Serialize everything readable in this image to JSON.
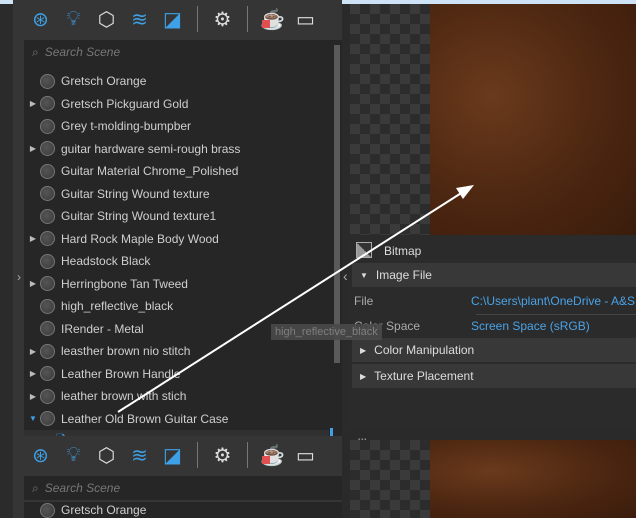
{
  "toolbar": {
    "icons": [
      "material-icon",
      "light-icon",
      "object-icon",
      "layers-icon",
      "texture-icon",
      "gear-icon",
      "teapot-render-icon",
      "window-icon"
    ]
  },
  "search": {
    "placeholder": "Search Scene"
  },
  "materials": [
    {
      "label": "Gretsch Orange",
      "expandable": false
    },
    {
      "label": "Gretsch Pickguard Gold",
      "expandable": true
    },
    {
      "label": "Grey t-molding-bumpber",
      "expandable": false
    },
    {
      "label": "guitar hardware semi-rough brass",
      "expandable": true
    },
    {
      "label": "Guitar Material Chrome_Polished",
      "expandable": false
    },
    {
      "label": "Guitar String Wound texture",
      "expandable": false
    },
    {
      "label": "Guitar String Wound texture1",
      "expandable": false
    },
    {
      "label": "Hard Rock Maple Body Wood",
      "expandable": true
    },
    {
      "label": "Headstock Black",
      "expandable": false
    },
    {
      "label": "Herringbone Tan Tweed",
      "expandable": true
    },
    {
      "label": "high_reflective_black",
      "expandable": false
    },
    {
      "label": "IRender - Metal",
      "expandable": false
    },
    {
      "label": "leasther brown nio stitch",
      "expandable": true
    },
    {
      "label": "Leather Brown Handle",
      "expandable": true
    },
    {
      "label": "leather brown with stich",
      "expandable": true
    },
    {
      "label": "Leather Old Brown Guitar Case",
      "expandable": true,
      "expanded": true
    }
  ],
  "child": {
    "label": "Bitmap"
  },
  "tooltip": "high_reflective_black",
  "bottom_list": {
    "first": "Gretsch Orange"
  },
  "props": {
    "title": "Bitmap",
    "image_file": "Image File",
    "file_label": "File",
    "file_value": "C:\\Users\\plant\\OneDrive - A&S C",
    "color_space_label": "Color Space",
    "color_space_value": "Screen Space (sRGB)",
    "color_manipulation": "Color Manipulation",
    "texture_placement": "Texture Placement"
  },
  "colors": {
    "accent": "#3ea0e6"
  }
}
